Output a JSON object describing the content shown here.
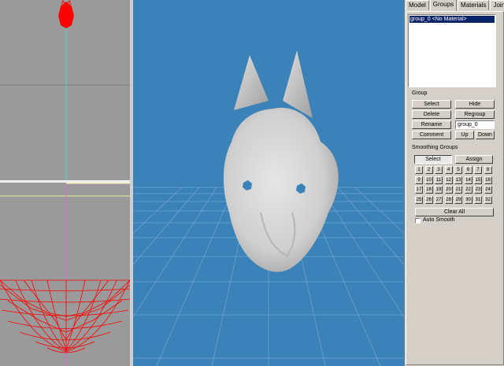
{
  "tabs": [
    {
      "label": "Model"
    },
    {
      "label": "Groups"
    },
    {
      "label": "Materials"
    },
    {
      "label": "Joints"
    }
  ],
  "active_tab": "Groups",
  "groups_list": {
    "items": [
      "group_0 <No Material>"
    ],
    "selected_index": 0
  },
  "group_section": {
    "title": "Group",
    "select_label": "Select",
    "hide_label": "Hide",
    "delete_label": "Delete",
    "regroup_label": "Regroup",
    "rename_label": "Rename",
    "name_value": "group_0",
    "comment_label": "Comment",
    "up_label": "Up",
    "down_label": "Down"
  },
  "smoothing_section": {
    "title": "Smoothing Groups",
    "select_label": "Select",
    "assign_label": "Assign",
    "numbers": [
      "1",
      "2",
      "3",
      "4",
      "5",
      "6",
      "7",
      "8",
      "9",
      "10",
      "11",
      "12",
      "13",
      "14",
      "15",
      "16",
      "17",
      "18",
      "19",
      "20",
      "21",
      "22",
      "23",
      "24",
      "25",
      "26",
      "27",
      "28",
      "29",
      "30",
      "31",
      "32"
    ],
    "clear_all_label": "Clear All",
    "auto_smooth_label": "Auto Smooth",
    "auto_smooth_checked": false
  },
  "colors": {
    "viewport_3d": "#3a82b8",
    "ortho_background": "#9a9a9a",
    "mesh_wire": "#ff0000",
    "selection_bg": "#0a246a"
  }
}
